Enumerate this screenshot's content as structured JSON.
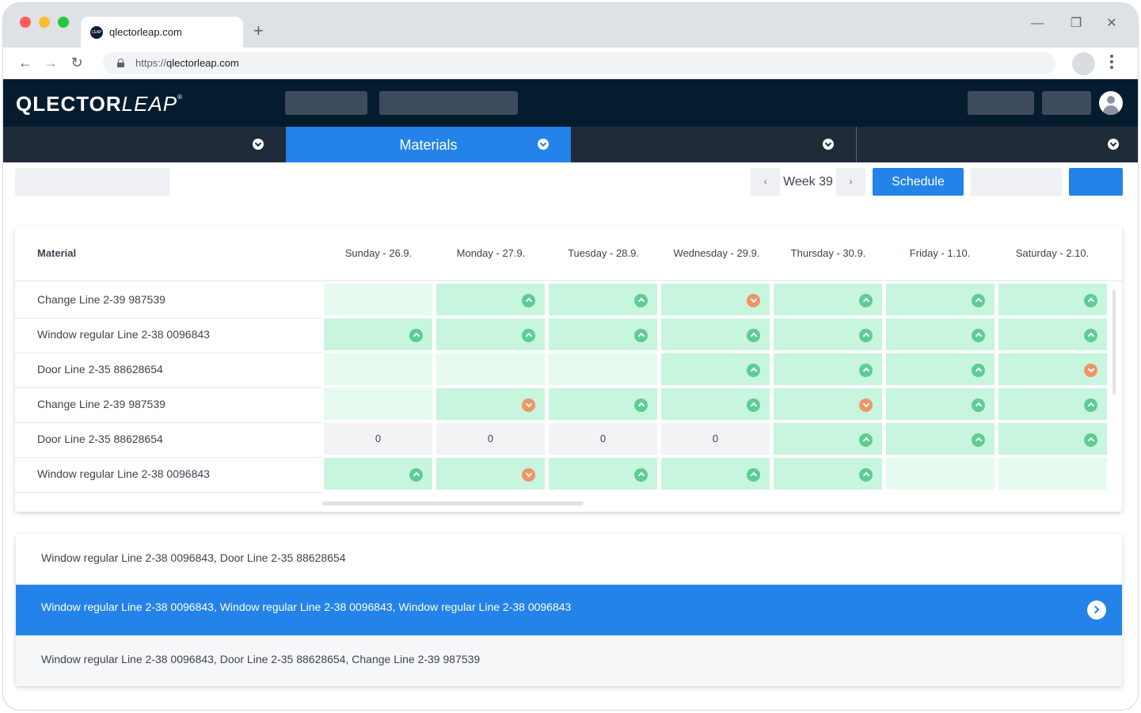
{
  "browser": {
    "tab_title": "qlectorleap.com",
    "favicon_text": "LEAP",
    "url_scheme": "https://",
    "url_host": "qlectorleap.com"
  },
  "app": {
    "logo_bold": "QLECTOR",
    "logo_light": "LEAP",
    "logo_mark": "®"
  },
  "nav": {
    "items": [
      {
        "label": "",
        "active": false
      },
      {
        "label": "Materials",
        "active": true
      },
      {
        "label": "",
        "active": false
      },
      {
        "label": "",
        "active": false
      }
    ]
  },
  "toolbar": {
    "week_label": "Week 39",
    "prev_glyph": "‹",
    "next_glyph": "›",
    "schedule_label": "Schedule"
  },
  "table": {
    "material_header": "Material",
    "days": [
      "Sunday - 26.9.",
      "Monday - 27.9.",
      "Tuesday - 28.9.",
      "Wednesday - 29.9.",
      "Thursday - 30.9.",
      "Friday - 1.10.",
      "Saturday - 2.10."
    ],
    "rows": [
      {
        "label": "Change Line 2-39 987539",
        "cells": [
          {
            "bg": "light",
            "st": ""
          },
          {
            "bg": "full",
            "st": "up"
          },
          {
            "bg": "full",
            "st": "up"
          },
          {
            "bg": "full",
            "st": "down"
          },
          {
            "bg": "full",
            "st": "up"
          },
          {
            "bg": "full",
            "st": "up"
          },
          {
            "bg": "full",
            "st": "up"
          }
        ]
      },
      {
        "label": "Window regular Line 2-38 0096843",
        "cells": [
          {
            "bg": "full",
            "st": "up"
          },
          {
            "bg": "full",
            "st": "up"
          },
          {
            "bg": "full",
            "st": "up"
          },
          {
            "bg": "full",
            "st": "up"
          },
          {
            "bg": "full",
            "st": "up"
          },
          {
            "bg": "full",
            "st": "up"
          },
          {
            "bg": "full",
            "st": "up"
          }
        ]
      },
      {
        "label": "Door  Line 2-35 88628654",
        "cells": [
          {
            "bg": "light",
            "st": ""
          },
          {
            "bg": "light",
            "st": ""
          },
          {
            "bg": "light",
            "st": ""
          },
          {
            "bg": "full",
            "st": "up"
          },
          {
            "bg": "full",
            "st": "up"
          },
          {
            "bg": "full",
            "st": "up"
          },
          {
            "bg": "full",
            "st": "down"
          }
        ]
      },
      {
        "label": "Change Line 2-39 987539",
        "cells": [
          {
            "bg": "light",
            "st": ""
          },
          {
            "bg": "full",
            "st": "down"
          },
          {
            "bg": "full",
            "st": "up"
          },
          {
            "bg": "full",
            "st": "up"
          },
          {
            "bg": "full",
            "st": "down"
          },
          {
            "bg": "full",
            "st": "up"
          },
          {
            "bg": "full",
            "st": "up"
          }
        ]
      },
      {
        "label": "Door  Line 2-35 88628654",
        "cells": [
          {
            "bg": "zero",
            "st": "",
            "value": "0"
          },
          {
            "bg": "zero",
            "st": "",
            "value": "0"
          },
          {
            "bg": "zero",
            "st": "",
            "value": "0"
          },
          {
            "bg": "zero",
            "st": "",
            "value": "0"
          },
          {
            "bg": "full",
            "st": "up"
          },
          {
            "bg": "full",
            "st": "up"
          },
          {
            "bg": "full",
            "st": "up"
          }
        ]
      },
      {
        "label": "Window regular Line 2-38 0096843",
        "cells": [
          {
            "bg": "full",
            "st": "up"
          },
          {
            "bg": "full",
            "st": "down"
          },
          {
            "bg": "full",
            "st": "up"
          },
          {
            "bg": "full",
            "st": "up"
          },
          {
            "bg": "full",
            "st": "up"
          },
          {
            "bg": "light",
            "st": ""
          },
          {
            "bg": "light",
            "st": ""
          }
        ]
      }
    ]
  },
  "suggestions": [
    {
      "text": "Window regular Line 2-38 0096843, Door  Line 2-35 88628654",
      "selected": false
    },
    {
      "text": "Window regular Line 2-38 0096843, Window regular Line 2-38 0096843, Window regular Line 2-38 0096843",
      "selected": true
    },
    {
      "text": "Window regular Line 2-38 0096843, Door  Line 2-35 88628654, Change Line 2-39 987539",
      "selected": false
    }
  ],
  "colors": {
    "accent": "#2383e8",
    "header_bg": "#051c2f",
    "nav_bg": "#202b3a",
    "status_up": "#5ccd93",
    "status_down": "#ee9567",
    "cell_full": "#c8f5de",
    "cell_light": "#e5fbf0"
  }
}
